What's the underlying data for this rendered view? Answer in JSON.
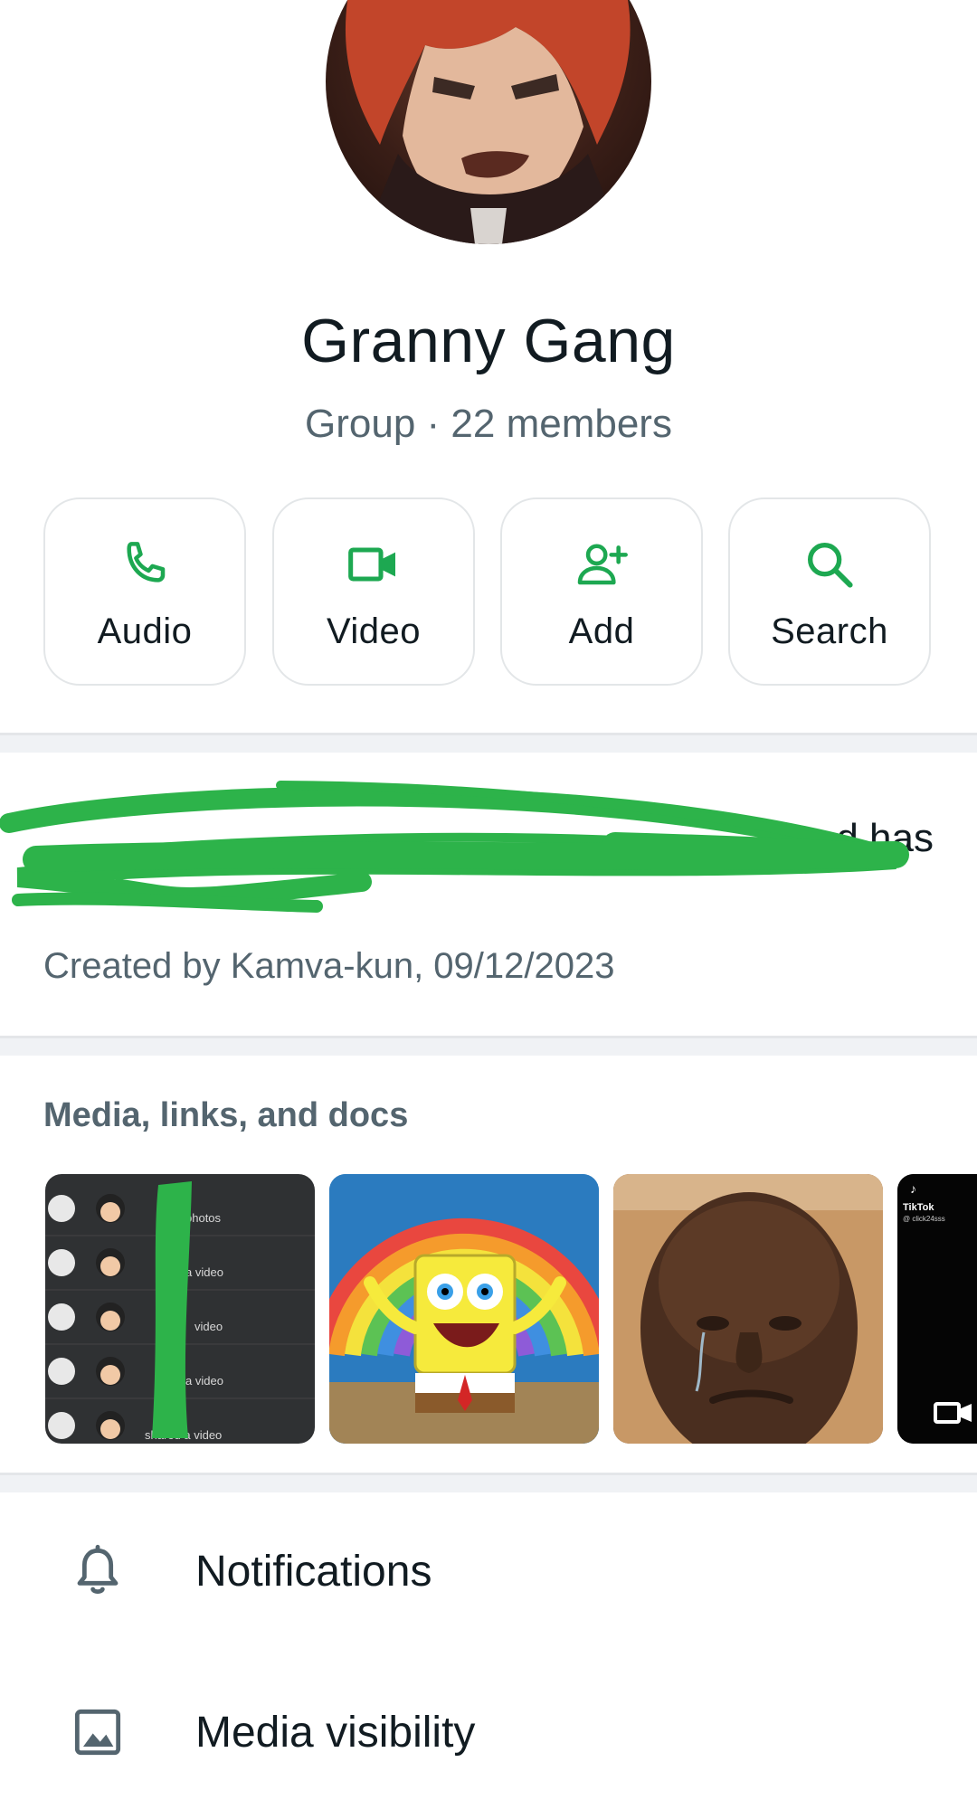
{
  "profile": {
    "name": "Granny Gang",
    "subtitle": "Group · 22 members"
  },
  "actions": [
    {
      "label": "Audio",
      "icon": "phone-icon"
    },
    {
      "label": "Video",
      "icon": "video-camera-icon"
    },
    {
      "label": "Add",
      "icon": "add-person-icon"
    },
    {
      "label": "Search",
      "icon": "search-icon"
    }
  ],
  "description": {
    "line1_end": "d has",
    "created": "Created by Kamva-kun, 09/12/2023"
  },
  "media": {
    "title": "Media, links, and docs",
    "thumb1_rows": [
      "photos",
      "a video",
      "video",
      "a video",
      "shared a video"
    ],
    "thumb4_brand": "TikTok",
    "thumb4_handle": "@ click24sss"
  },
  "settings": {
    "items": [
      {
        "label": "Notifications",
        "icon": "bell-icon"
      },
      {
        "label": "Media visibility",
        "icon": "image-icon"
      }
    ]
  },
  "colors": {
    "accent": "#1da851",
    "scribble": "#2db34a",
    "text_primary": "#111b21",
    "text_secondary": "#54656f"
  }
}
